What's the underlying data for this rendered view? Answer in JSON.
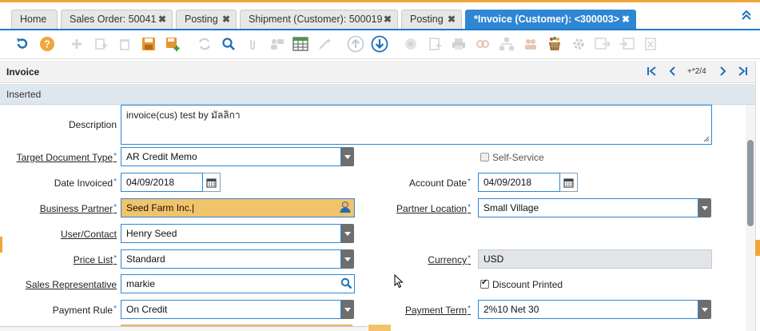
{
  "tabs": [
    {
      "label": "Home",
      "closable": false
    },
    {
      "label": "Sales Order: 50041",
      "closable": true
    },
    {
      "label": "Posting",
      "closable": true
    },
    {
      "label": "Shipment (Customer): 500019",
      "closable": true
    },
    {
      "label": "Posting",
      "closable": true
    },
    {
      "label": "*Invoice (Customer): <300003>",
      "closable": true,
      "active": true
    }
  ],
  "toolbar_icons": [
    "undo-icon",
    "help-icon",
    "new-icon",
    "copy-icon",
    "delete-icon",
    "save-icon",
    "save-new-icon",
    "refresh-icon",
    "find-icon",
    "attachment-icon",
    "chat-icon",
    "grid-toggle-icon",
    "wizard-icon",
    "parent-icon",
    "detail-icon",
    "archive-icon",
    "report-icon",
    "print-icon",
    "zoom-across-icon",
    "product-info-icon",
    "request-icon",
    "checkout-icon",
    "process-icon",
    "export-icon",
    "import-icon",
    "excel-icon"
  ],
  "header": {
    "title": "Invoice",
    "record_position": "+*2/4",
    "status": "Inserted"
  },
  "form": {
    "description_label": "Description",
    "description_value": "invoice(cus) test by มัลลิกา",
    "target_doc_type_label": "Target Document Type",
    "target_doc_type_value": "AR Credit Memo",
    "self_service_label": "Self-Service",
    "date_invoiced_label": "Date Invoiced",
    "date_invoiced_value": "04/09/2018",
    "account_date_label": "Account Date",
    "account_date_value": "04/09/2018",
    "business_partner_label": "Business Partner",
    "business_partner_value": "Seed Farm Inc.",
    "partner_location_label": "Partner Location",
    "partner_location_value": "Small Village",
    "user_contact_label": "User/Contact",
    "user_contact_value": "Henry Seed",
    "price_list_label": "Price List",
    "price_list_value": "Standard",
    "currency_label": "Currency",
    "currency_value": "USD",
    "sales_rep_label": "Sales Representative",
    "sales_rep_value": "markie",
    "discount_printed_label": "Discount Printed",
    "payment_rule_label": "Payment Rule",
    "payment_rule_value": "On Credit",
    "payment_term_label": "Payment Term",
    "payment_term_value": "2%10 Net 30"
  },
  "colors": {
    "accent": "#2f86d4",
    "orange": "#f0a63a",
    "highlight_field": "#f2c36b"
  }
}
